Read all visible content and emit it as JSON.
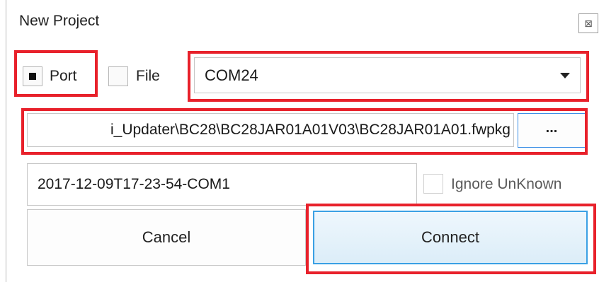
{
  "window": {
    "title": "New Project",
    "close_glyph": "⊠"
  },
  "source": {
    "port_label": "Port",
    "port_checked": true,
    "file_label": "File",
    "file_checked": false
  },
  "port_select": {
    "value": "COM24"
  },
  "firmware": {
    "path": "i_Updater\\BC28\\BC28JAR01A01V03\\BC28JAR01A01.fwpkg",
    "browse_label": "..."
  },
  "log": {
    "name": "2017-12-09T17-23-54-COM1"
  },
  "ignore_unknown": {
    "label": "Ignore UnKnown",
    "checked": false
  },
  "actions": {
    "cancel_label": "Cancel",
    "connect_label": "Connect"
  },
  "colors": {
    "highlight": "#e8212b",
    "focus_blue": "#3aa0e4"
  }
}
